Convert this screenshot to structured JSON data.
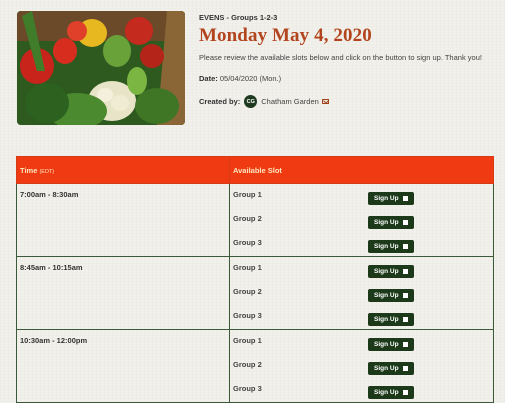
{
  "event": {
    "subtitle": "EVENS - Groups 1-2-3",
    "title": "Monday May 4, 2020",
    "description": "Please review the available slots below and click on the button to sign up. Thank you!",
    "date_label": "Date:",
    "date_value": "05/04/2020 (Mon.)",
    "created_by_label": "Created by:",
    "creator_initials": "CG",
    "creator_name": "Chatham Garden"
  },
  "table": {
    "time_header": "Time",
    "time_zone": "(EDT)",
    "slot_header": "Available Slot",
    "signup_label": "Sign Up",
    "rows": [
      {
        "time": "7:00am - 8:30am",
        "slots": [
          "Group 1",
          "Group 2",
          "Group 3"
        ]
      },
      {
        "time": "8:45am - 10:15am",
        "slots": [
          "Group 1",
          "Group 2",
          "Group 3"
        ]
      },
      {
        "time": "10:30am - 12:00pm",
        "slots": [
          "Group 1",
          "Group 2",
          "Group 3"
        ]
      }
    ]
  },
  "colors": {
    "accent": "#b3451e",
    "header_bg": "#f03a11",
    "button_bg": "#1c3a1a"
  }
}
